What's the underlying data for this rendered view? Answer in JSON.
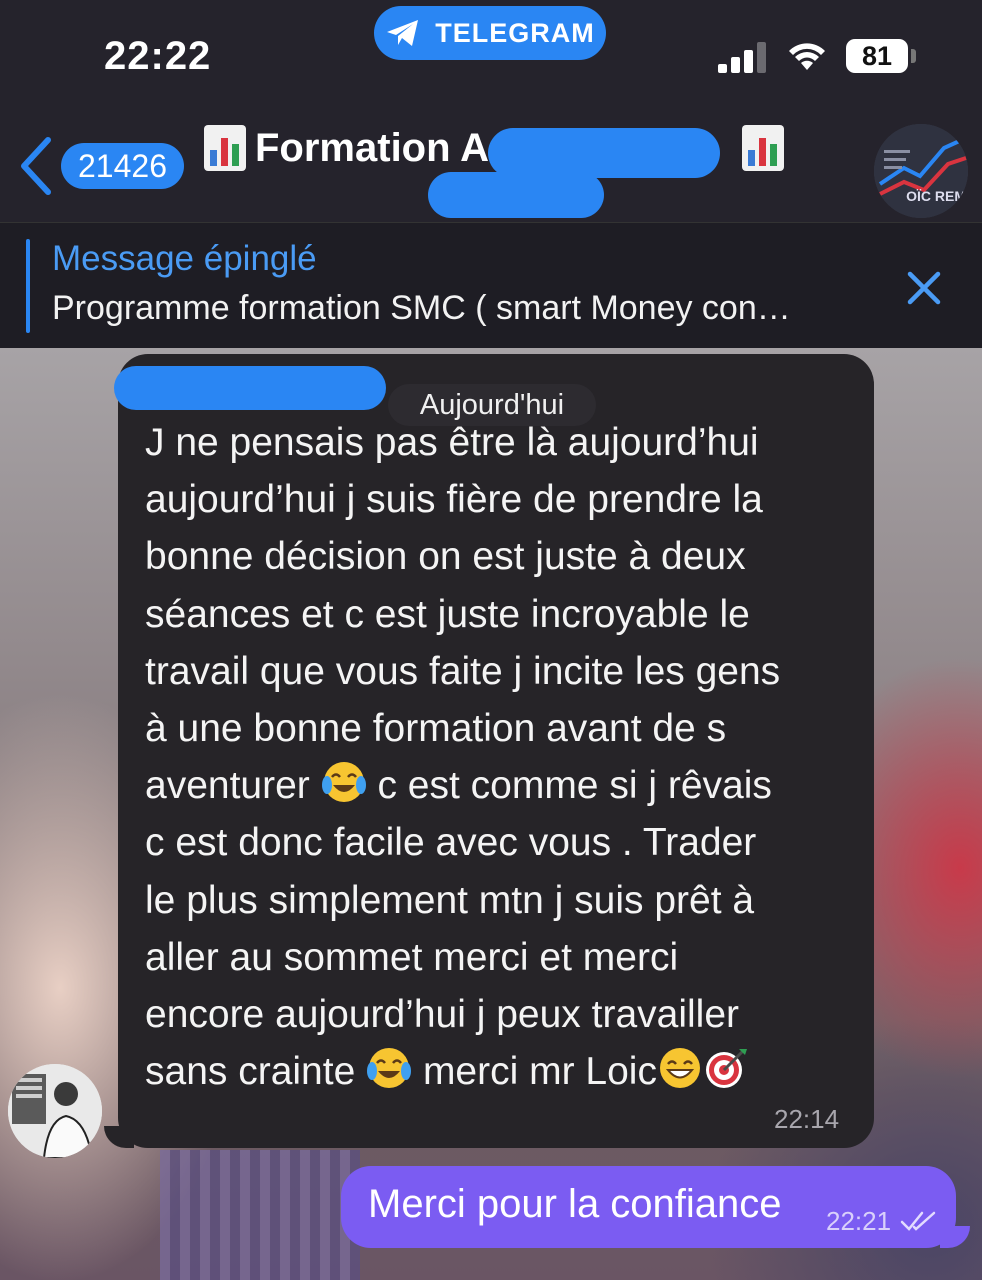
{
  "status_bar": {
    "time": "22:22",
    "pill_label": "TELEGRAM",
    "battery": "81",
    "icons": [
      "telegram-plane-icon",
      "signal-icon",
      "wifi-icon",
      "battery-icon"
    ]
  },
  "header": {
    "back_count": "21426",
    "title": "Formation A",
    "title_icon": "bar-chart-emoji",
    "avatar_text": "OÏC REM"
  },
  "pinned": {
    "title": "Message épinglé",
    "text": "Programme formation SMC ( smart Money con…"
  },
  "chat": {
    "date_chip": "Aujourd'hui",
    "incoming": {
      "lines": [
        "J ne pensais pas être là aujourd’hui",
        "aujourd’hui j suis fière de prendre la",
        "bonne décision on est juste à deux",
        "séances et c est juste incroyable le",
        "travail que vous faite j incite les gens",
        "à une bonne formation avant de s"
      ],
      "line7_before": "aventurer ",
      "line7_after": " c est comme si j rêvais",
      "lines_mid": [
        "c est donc facile avec vous . Trader",
        "le plus simplement mtn j suis prêt à",
        "aller au sommet  merci et merci",
        "encore aujourd’hui j peux travailler"
      ],
      "last_before": "sans crainte ",
      "last_after": " merci mr Loic",
      "time": "22:14"
    },
    "outgoing": {
      "text": "Merci pour la confiance",
      "time": "22:21"
    }
  },
  "colors": {
    "accent": "#2a86f3",
    "outgoing_bubble": "#7b5cf2",
    "incoming_bubble": "#262428"
  }
}
